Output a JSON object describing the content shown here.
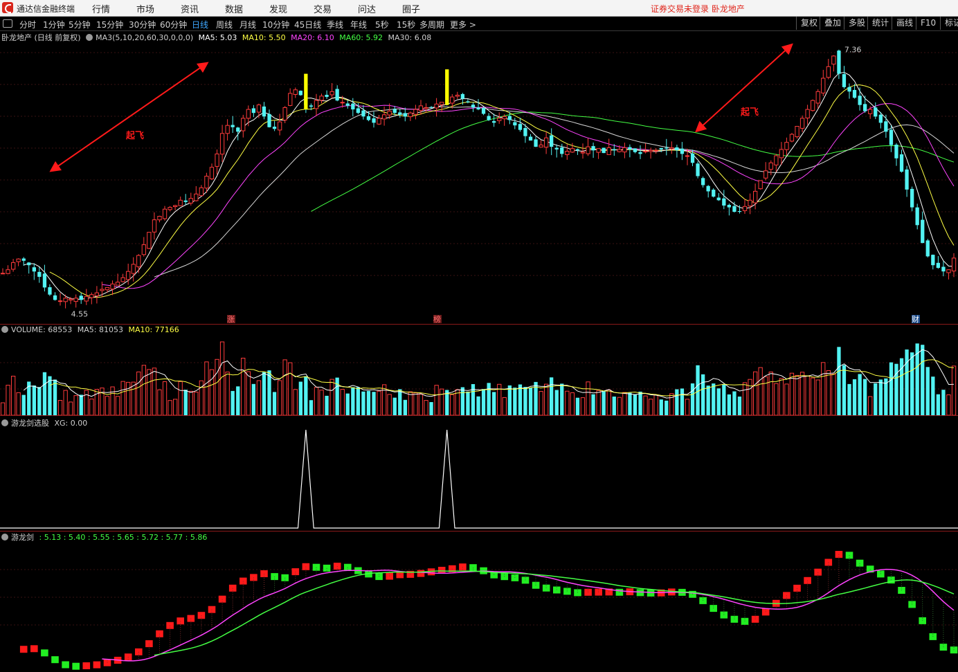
{
  "app": {
    "title": "通达信金融终端"
  },
  "menu": [
    "行情",
    "市场",
    "资讯",
    "数据",
    "发现",
    "交易",
    "问达",
    "圈子"
  ],
  "alert": "证券交易未登录  卧龙地产",
  "periods": {
    "items": [
      "分时",
      "1分钟",
      "5分钟",
      "15分钟",
      "30分钟",
      "60分钟",
      "日线",
      "周线",
      "月线",
      "10分钟",
      "45日线",
      "季线",
      "年线",
      "5秒",
      "15秒",
      "多周期",
      "更多 >"
    ],
    "active": "日线"
  },
  "toolbar": [
    "复权",
    "叠加",
    "多股",
    "统计",
    "画线",
    "F10",
    "标记"
  ],
  "main_info": {
    "stock": "卧龙地产 (日线 前复权)",
    "ma_def": "MA3(5,10,20,60,30,0,0,0)",
    "ma5": "MA5: 5.03",
    "ma10": "MA10: 5.50",
    "ma20": "MA20: 6.10",
    "ma60": "MA60: 5.92",
    "ma30": "MA30: 6.08"
  },
  "volume_info": {
    "vol": "VOLUME: 68553",
    "ma5": "MA5: 81053",
    "ma10": "MA10: 77166"
  },
  "xg_info": {
    "name": "游龙剑选股",
    "xg": "XG: 0.00"
  },
  "ylj_info": {
    "name": "游龙剑",
    "values": ": 5.13 : 5.40 : 5.55 : 5.65 : 5.72 : 5.77 : 5.86"
  },
  "colors": {
    "up": "#ff3b3b",
    "down": "#52f2f2",
    "ma5": "#ffffff",
    "ma10": "#ffff44",
    "ma20": "#ff44ff",
    "ma60": "#44ff44",
    "signal": "#ffff00",
    "arrow": "#ff1a1a"
  },
  "chart_data": [
    {
      "type": "candlestick",
      "panel": "price",
      "price_high_label": "7.36",
      "price_low_label": "4.55",
      "annotations": [
        "起飞",
        "起飞"
      ],
      "event_markers": [
        "涨",
        "榜",
        "财"
      ],
      "series": [
        {
          "name": "MA5"
        },
        {
          "name": "MA10"
        },
        {
          "name": "MA20"
        },
        {
          "name": "MA60"
        },
        {
          "name": "MA30"
        }
      ],
      "close": [
        4.86,
        4.9,
        4.98,
        5.02,
        5.0,
        4.95,
        4.88,
        4.82,
        4.7,
        4.62,
        4.56,
        4.55,
        4.58,
        4.57,
        4.58,
        4.56,
        4.6,
        4.62,
        4.64,
        4.68,
        4.7,
        4.74,
        4.76,
        4.81,
        4.88,
        4.96,
        5.06,
        5.18,
        5.32,
        5.46,
        5.5,
        5.58,
        5.6,
        5.62,
        5.68,
        5.66,
        5.7,
        5.75,
        5.82,
        5.95,
        6.05,
        6.2,
        6.43,
        6.52,
        6.5,
        6.45,
        6.6,
        6.7,
        6.66,
        6.75,
        6.62,
        6.5,
        6.48,
        6.56,
        6.72,
        6.88,
        6.92,
        6.86,
        6.75,
        6.73,
        6.8,
        6.85,
        6.84,
        6.9,
        6.8,
        6.78,
        6.74,
        6.7,
        6.66,
        6.62,
        6.58,
        6.55,
        6.6,
        6.64,
        6.68,
        6.66,
        6.64,
        6.62,
        6.66,
        6.7,
        6.74,
        6.72,
        6.72,
        6.76,
        6.78,
        6.8,
        6.84,
        6.86,
        6.82,
        6.78,
        6.72,
        6.7,
        6.65,
        6.58,
        6.55,
        6.6,
        6.62,
        6.58,
        6.52,
        6.47,
        6.4,
        6.35,
        6.28,
        6.3,
        6.38,
        6.28,
        6.25,
        6.2,
        6.23,
        6.26,
        6.24,
        6.22,
        6.28,
        6.24,
        6.26,
        6.21,
        6.27,
        6.24,
        6.25,
        6.27,
        6.25,
        6.22,
        6.2,
        6.23,
        6.24,
        6.24,
        6.25,
        6.26,
        6.27,
        6.24,
        6.2,
        6.18,
        6.1,
        5.95,
        5.85,
        5.78,
        5.72,
        5.68,
        5.62,
        5.6,
        5.55,
        5.55,
        5.61,
        5.68,
        5.78,
        5.9,
        6.01,
        6.1,
        6.18,
        6.25,
        6.33,
        6.42,
        6.51,
        6.6,
        6.7,
        6.8,
        6.9,
        7.05,
        7.18,
        7.3,
        7.1,
        6.95,
        6.9,
        6.83,
        6.75,
        6.68,
        6.7,
        6.62,
        6.55,
        6.45,
        6.3,
        6.15,
        6.0,
        5.8,
        5.6,
        5.4,
        5.2,
        5.05,
        4.95,
        4.92,
        4.88,
        4.9,
        5.03
      ],
      "ylim": [
        4.4,
        7.4
      ]
    },
    {
      "type": "bar",
      "panel": "volume",
      "series": [
        {
          "name": "VOLUME"
        },
        {
          "name": "MA5"
        },
        {
          "name": "MA10"
        }
      ]
    },
    {
      "type": "line",
      "panel": "游龙剑选股",
      "signal_positions": [
        "spike",
        "spike"
      ]
    },
    {
      "type": "step-band",
      "panel": "游龙剑",
      "series": [
        {
          "name": "游龙剑"
        }
      ]
    }
  ]
}
